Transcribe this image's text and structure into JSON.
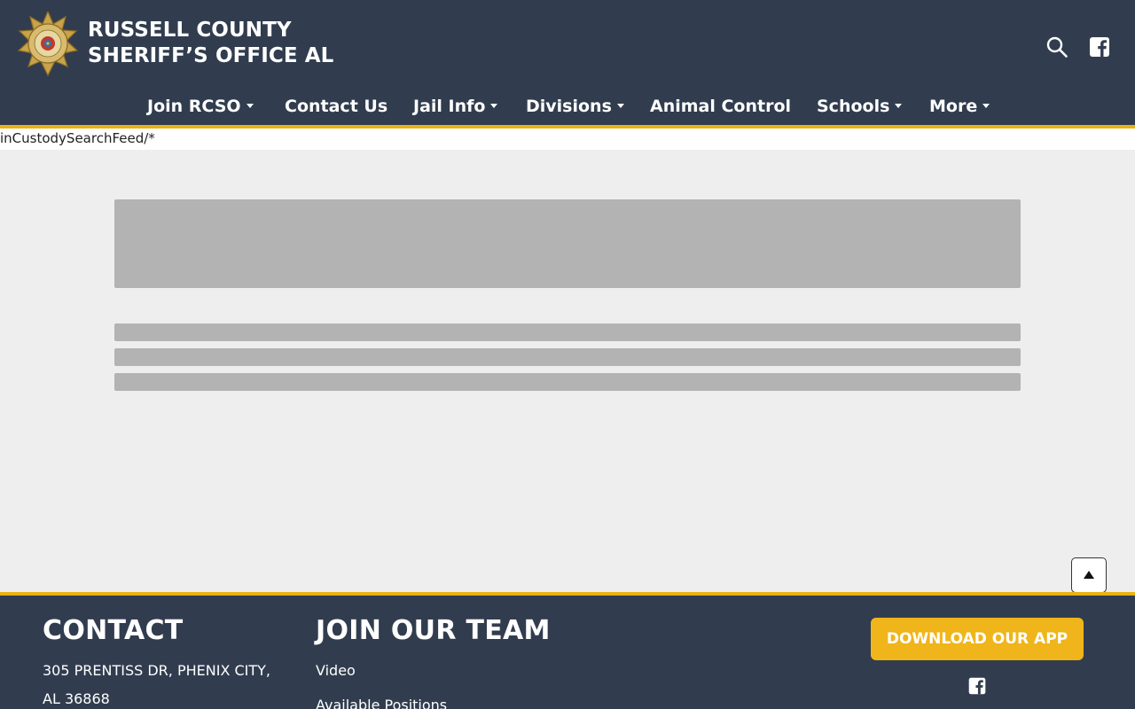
{
  "header": {
    "title_line1": "RUSSELL COUNTY",
    "title_line2": "SHERIFF’S OFFICE AL",
    "logo_icon": "sheriff-star-badge",
    "search_icon": "search-icon",
    "social_icon": "facebook-icon"
  },
  "nav": {
    "items": [
      {
        "label": "Join RCSO",
        "has_dropdown": true
      },
      {
        "label": "Contact Us",
        "has_dropdown": false
      },
      {
        "label": "Jail Info",
        "has_dropdown": true
      },
      {
        "label": "Divisions",
        "has_dropdown": true
      },
      {
        "label": "Animal Control",
        "has_dropdown": false
      },
      {
        "label": "Schools",
        "has_dropdown": true
      },
      {
        "label": "More",
        "has_dropdown": true
      }
    ]
  },
  "feed": {
    "raw_text": "inCustodySearchFeed/*"
  },
  "back_to_top": {
    "icon": "arrow-up-icon"
  },
  "footer": {
    "contact": {
      "heading": "CONTACT",
      "address_line1": "305 PRENTISS DR, PHENIX CITY,",
      "address_line2": "AL 36868"
    },
    "join": {
      "heading": "JOIN OUR TEAM",
      "links": [
        "Video",
        "Available Positions"
      ]
    },
    "app_button": "DOWNLOAD OUR APP",
    "social_icon": "facebook-icon"
  },
  "colors": {
    "header_bg": "#313d4f",
    "accent_gold": "#e9b314",
    "button_gold": "#f0b51a",
    "page_bg": "#eeeeee",
    "skeleton": "#b3b3b3"
  }
}
